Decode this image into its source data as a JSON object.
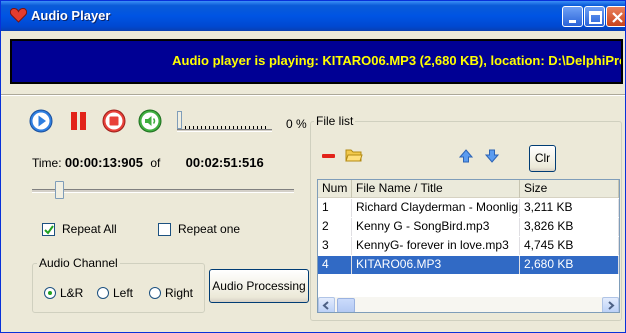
{
  "window": {
    "title": "Audio Player",
    "status_text": "Audio player is playing: KITARO06.MP3 (2,680 KB), location: D:\\DelphiPro"
  },
  "playback": {
    "volume_percent": "0 %",
    "time_label": "Time:",
    "elapsed": "00:00:13:905",
    "of_label": "of",
    "total": "00:02:51:516",
    "seek_position_fraction": 0.09
  },
  "options": {
    "repeat_all_label": "Repeat All",
    "repeat_all_checked": true,
    "repeat_one_label": "Repeat one",
    "repeat_one_checked": false
  },
  "audio_channel": {
    "title": "Audio Channel",
    "options": [
      "L&R",
      "Left",
      "Right"
    ],
    "selected": "L&R"
  },
  "buttons": {
    "audio_processing": "Audio Processing",
    "clear": "Clr"
  },
  "file_list": {
    "title": "File list",
    "columns": [
      "Num",
      "File Name / Title",
      "Size"
    ],
    "rows": [
      {
        "num": "1",
        "name": "Richard Clayderman - Moonligh",
        "size": "3,211 KB",
        "selected": false
      },
      {
        "num": "2",
        "name": "Kenny G - SongBird.mp3",
        "size": "3,826 KB",
        "selected": false
      },
      {
        "num": "3",
        "name": "KennyG- forever in love.mp3",
        "size": "4,745 KB",
        "selected": false
      },
      {
        "num": "4",
        "name": "KITARO06.MP3",
        "size": "2,680 KB",
        "selected": true
      }
    ]
  },
  "icons": {
    "app": "heart-icon",
    "play": "play-icon",
    "pause": "pause-icon",
    "stop": "stop-icon",
    "mute": "speaker-icon",
    "remove": "minus-icon",
    "open": "folder-icon",
    "move_up": "arrow-up-icon",
    "move_down": "arrow-down-icon"
  },
  "colors": {
    "status_bg": "#000094",
    "status_text": "#ffff00",
    "selection": "#316ac5",
    "title_bar": "#0054e3"
  }
}
